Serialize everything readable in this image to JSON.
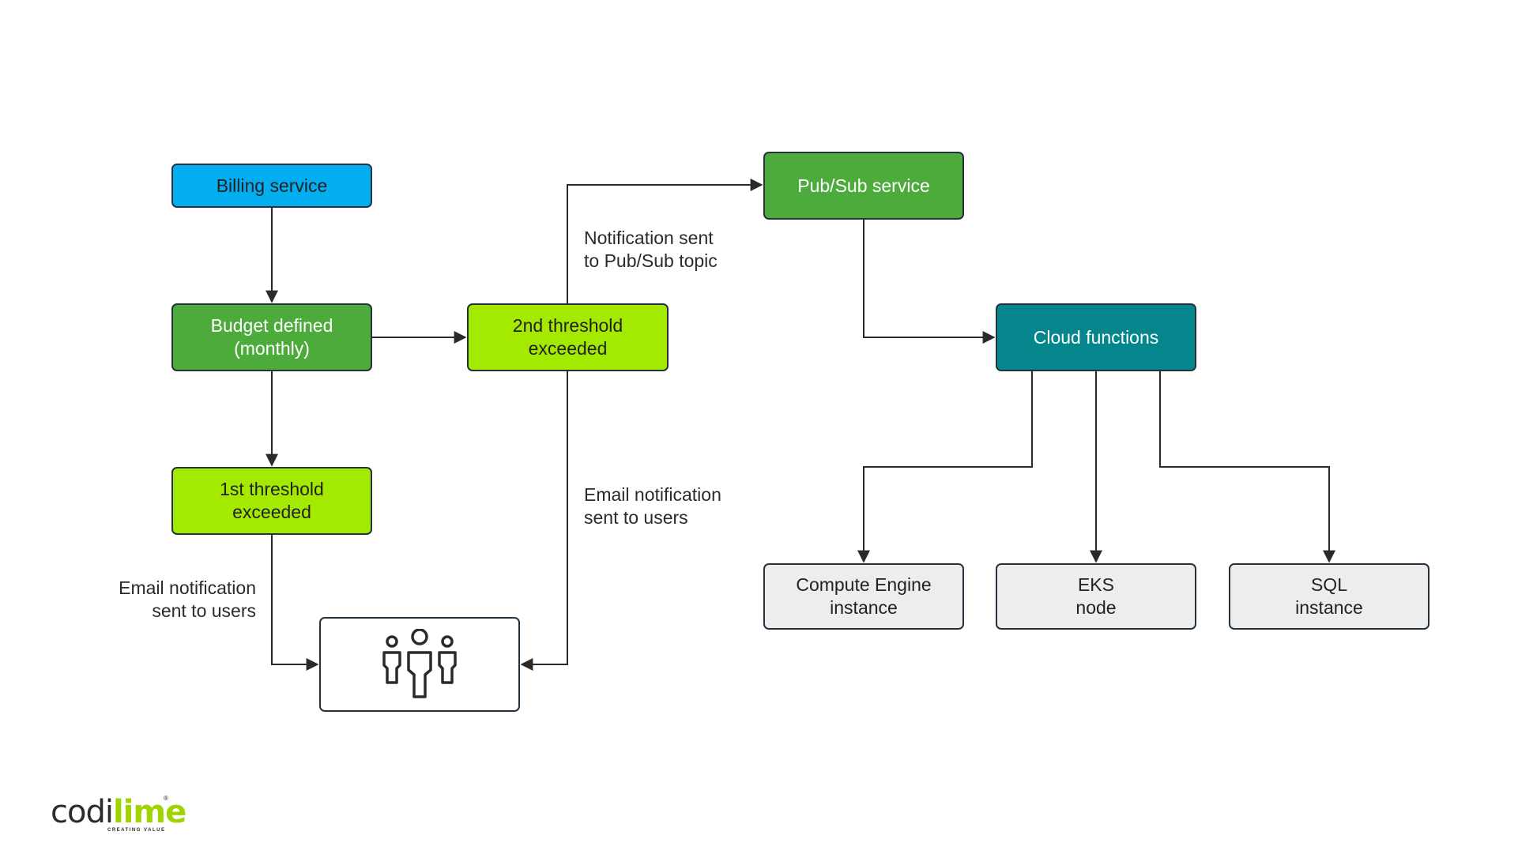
{
  "diagram": {
    "nodes": {
      "billing": "Billing service",
      "budget": "Budget defined\n(monthly)",
      "second_threshold": "2nd threshold\nexceeded",
      "first_threshold": "1st threshold\nexceeded",
      "users": "",
      "pubsub": "Pub/Sub service",
      "cloud_functions": "Cloud functions",
      "compute_engine": "Compute Engine\ninstance",
      "eks": "EKS\nnode",
      "sql": "SQL\ninstance"
    },
    "edge_labels": {
      "to_pubsub": "Notification sent\nto Pub/Sub topic",
      "email_from_second": "Email notification\nsent to users",
      "email_from_first": "Email notification\nsent to users"
    },
    "edges": [
      {
        "from": "billing",
        "to": "budget"
      },
      {
        "from": "budget",
        "to": "second_threshold"
      },
      {
        "from": "budget",
        "to": "first_threshold"
      },
      {
        "from": "first_threshold",
        "to": "users",
        "label": "Email notification sent to users"
      },
      {
        "from": "second_threshold",
        "to": "users",
        "label": "Email notification sent to users"
      },
      {
        "from": "second_threshold",
        "to": "pubsub",
        "label": "Notification sent to Pub/Sub topic"
      },
      {
        "from": "pubsub",
        "to": "cloud_functions"
      },
      {
        "from": "cloud_functions",
        "to": "compute_engine"
      },
      {
        "from": "cloud_functions",
        "to": "eks"
      },
      {
        "from": "cloud_functions",
        "to": "sql"
      }
    ],
    "colors": {
      "billing": "#02aeef",
      "green": "#4dab3c",
      "lime": "#a3ea00",
      "teal": "#05868c",
      "grey": "#ededed"
    }
  },
  "logo": {
    "part1": "codi",
    "part2": "lime",
    "tagline": "CREATING VALUE",
    "registered": "®"
  }
}
